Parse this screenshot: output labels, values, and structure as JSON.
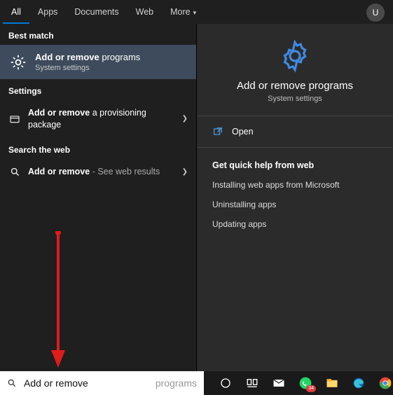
{
  "tabs": {
    "all": "All",
    "apps": "Apps",
    "documents": "Documents",
    "web": "Web",
    "more": "More"
  },
  "user": {
    "initial": "U"
  },
  "left": {
    "best_match_header": "Best match",
    "best_match": {
      "bold": "Add or remove",
      "rest": " programs",
      "subtitle": "System settings"
    },
    "settings_header": "Settings",
    "setting1": {
      "bold": "Add or remove",
      "rest": " a provisioning package"
    },
    "web_header": "Search the web",
    "web1": {
      "bold": "Add or remove",
      "rest": " - See web results"
    }
  },
  "right": {
    "title": "Add or remove programs",
    "subtitle": "System settings",
    "open": "Open",
    "quick_help_header": "Get quick help from web",
    "links": {
      "l1": "Installing web apps from Microsoft",
      "l2": "Uninstalling apps",
      "l3": "Updating apps"
    }
  },
  "search": {
    "value": "Add or remove ",
    "placeholder": "programs"
  },
  "taskbar": {
    "whatsapp_badge": "34"
  }
}
